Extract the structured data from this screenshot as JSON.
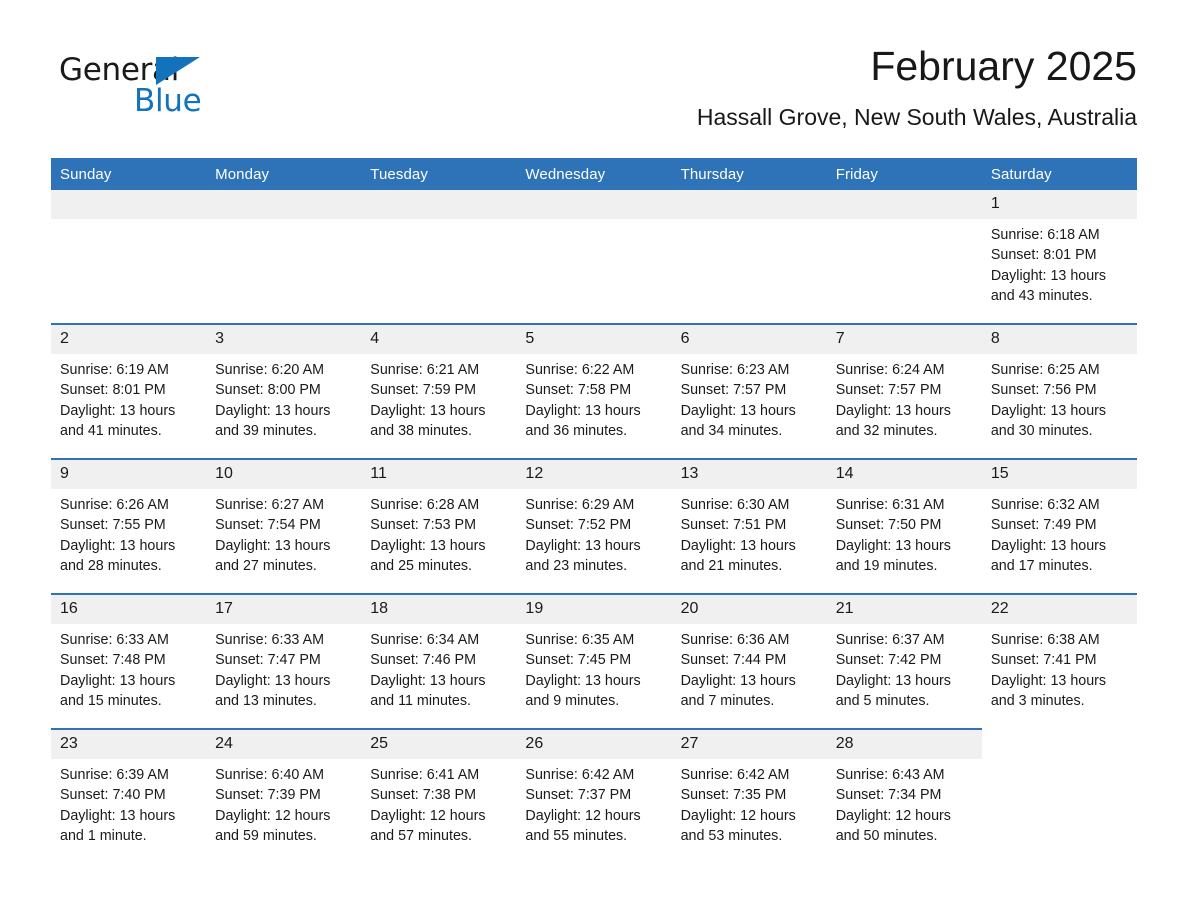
{
  "brand": {
    "name_part1": "General",
    "name_part2": "Blue",
    "triangle_color": "#1273BC"
  },
  "header": {
    "month_title": "February 2025",
    "location": "Hassall Grove, New South Wales, Australia"
  },
  "theme": {
    "header_blue": "#2E72B8",
    "daynum_band": "#F0F0F0",
    "text": "#1a1a1a"
  },
  "calendar": {
    "weekday_headers": [
      "Sunday",
      "Monday",
      "Tuesday",
      "Wednesday",
      "Thursday",
      "Friday",
      "Saturday"
    ],
    "weeks": [
      [
        {
          "day": "",
          "empty": true
        },
        {
          "day": "",
          "empty": true
        },
        {
          "day": "",
          "empty": true
        },
        {
          "day": "",
          "empty": true
        },
        {
          "day": "",
          "empty": true
        },
        {
          "day": "",
          "empty": true
        },
        {
          "day": "1",
          "sunrise": "Sunrise: 6:18 AM",
          "sunset": "Sunset: 8:01 PM",
          "daylight": "Daylight: 13 hours and 43 minutes."
        }
      ],
      [
        {
          "day": "2",
          "sunrise": "Sunrise: 6:19 AM",
          "sunset": "Sunset: 8:01 PM",
          "daylight": "Daylight: 13 hours and 41 minutes."
        },
        {
          "day": "3",
          "sunrise": "Sunrise: 6:20 AM",
          "sunset": "Sunset: 8:00 PM",
          "daylight": "Daylight: 13 hours and 39 minutes."
        },
        {
          "day": "4",
          "sunrise": "Sunrise: 6:21 AM",
          "sunset": "Sunset: 7:59 PM",
          "daylight": "Daylight: 13 hours and 38 minutes."
        },
        {
          "day": "5",
          "sunrise": "Sunrise: 6:22 AM",
          "sunset": "Sunset: 7:58 PM",
          "daylight": "Daylight: 13 hours and 36 minutes."
        },
        {
          "day": "6",
          "sunrise": "Sunrise: 6:23 AM",
          "sunset": "Sunset: 7:57 PM",
          "daylight": "Daylight: 13 hours and 34 minutes."
        },
        {
          "day": "7",
          "sunrise": "Sunrise: 6:24 AM",
          "sunset": "Sunset: 7:57 PM",
          "daylight": "Daylight: 13 hours and 32 minutes."
        },
        {
          "day": "8",
          "sunrise": "Sunrise: 6:25 AM",
          "sunset": "Sunset: 7:56 PM",
          "daylight": "Daylight: 13 hours and 30 minutes."
        }
      ],
      [
        {
          "day": "9",
          "sunrise": "Sunrise: 6:26 AM",
          "sunset": "Sunset: 7:55 PM",
          "daylight": "Daylight: 13 hours and 28 minutes."
        },
        {
          "day": "10",
          "sunrise": "Sunrise: 6:27 AM",
          "sunset": "Sunset: 7:54 PM",
          "daylight": "Daylight: 13 hours and 27 minutes."
        },
        {
          "day": "11",
          "sunrise": "Sunrise: 6:28 AM",
          "sunset": "Sunset: 7:53 PM",
          "daylight": "Daylight: 13 hours and 25 minutes."
        },
        {
          "day": "12",
          "sunrise": "Sunrise: 6:29 AM",
          "sunset": "Sunset: 7:52 PM",
          "daylight": "Daylight: 13 hours and 23 minutes."
        },
        {
          "day": "13",
          "sunrise": "Sunrise: 6:30 AM",
          "sunset": "Sunset: 7:51 PM",
          "daylight": "Daylight: 13 hours and 21 minutes."
        },
        {
          "day": "14",
          "sunrise": "Sunrise: 6:31 AM",
          "sunset": "Sunset: 7:50 PM",
          "daylight": "Daylight: 13 hours and 19 minutes."
        },
        {
          "day": "15",
          "sunrise": "Sunrise: 6:32 AM",
          "sunset": "Sunset: 7:49 PM",
          "daylight": "Daylight: 13 hours and 17 minutes."
        }
      ],
      [
        {
          "day": "16",
          "sunrise": "Sunrise: 6:33 AM",
          "sunset": "Sunset: 7:48 PM",
          "daylight": "Daylight: 13 hours and 15 minutes."
        },
        {
          "day": "17",
          "sunrise": "Sunrise: 6:33 AM",
          "sunset": "Sunset: 7:47 PM",
          "daylight": "Daylight: 13 hours and 13 minutes."
        },
        {
          "day": "18",
          "sunrise": "Sunrise: 6:34 AM",
          "sunset": "Sunset: 7:46 PM",
          "daylight": "Daylight: 13 hours and 11 minutes."
        },
        {
          "day": "19",
          "sunrise": "Sunrise: 6:35 AM",
          "sunset": "Sunset: 7:45 PM",
          "daylight": "Daylight: 13 hours and 9 minutes."
        },
        {
          "day": "20",
          "sunrise": "Sunrise: 6:36 AM",
          "sunset": "Sunset: 7:44 PM",
          "daylight": "Daylight: 13 hours and 7 minutes."
        },
        {
          "day": "21",
          "sunrise": "Sunrise: 6:37 AM",
          "sunset": "Sunset: 7:42 PM",
          "daylight": "Daylight: 13 hours and 5 minutes."
        },
        {
          "day": "22",
          "sunrise": "Sunrise: 6:38 AM",
          "sunset": "Sunset: 7:41 PM",
          "daylight": "Daylight: 13 hours and 3 minutes."
        }
      ],
      [
        {
          "day": "23",
          "sunrise": "Sunrise: 6:39 AM",
          "sunset": "Sunset: 7:40 PM",
          "daylight": "Daylight: 13 hours and 1 minute."
        },
        {
          "day": "24",
          "sunrise": "Sunrise: 6:40 AM",
          "sunset": "Sunset: 7:39 PM",
          "daylight": "Daylight: 12 hours and 59 minutes."
        },
        {
          "day": "25",
          "sunrise": "Sunrise: 6:41 AM",
          "sunset": "Sunset: 7:38 PM",
          "daylight": "Daylight: 12 hours and 57 minutes."
        },
        {
          "day": "26",
          "sunrise": "Sunrise: 6:42 AM",
          "sunset": "Sunset: 7:37 PM",
          "daylight": "Daylight: 12 hours and 55 minutes."
        },
        {
          "day": "27",
          "sunrise": "Sunrise: 6:42 AM",
          "sunset": "Sunset: 7:35 PM",
          "daylight": "Daylight: 12 hours and 53 minutes."
        },
        {
          "day": "28",
          "sunrise": "Sunrise: 6:43 AM",
          "sunset": "Sunset: 7:34 PM",
          "daylight": "Daylight: 12 hours and 50 minutes."
        },
        {
          "day": "",
          "empty": true,
          "blank_tail": true
        }
      ]
    ]
  }
}
